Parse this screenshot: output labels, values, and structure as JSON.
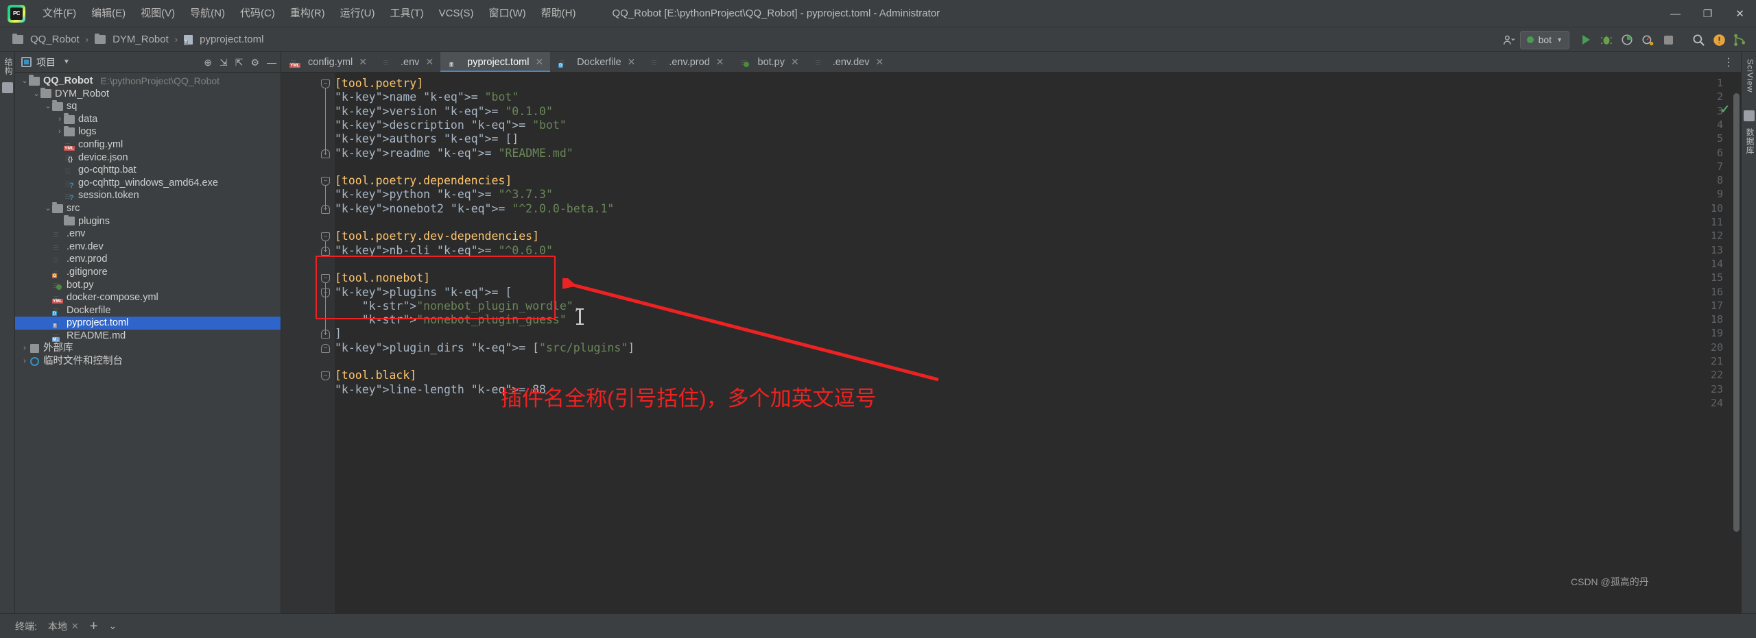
{
  "titlebar": {
    "logo_text": "PC",
    "menus": [
      {
        "label": "文件(F)"
      },
      {
        "label": "编辑(E)"
      },
      {
        "label": "视图(V)"
      },
      {
        "label": "导航(N)"
      },
      {
        "label": "代码(C)"
      },
      {
        "label": "重构(R)"
      },
      {
        "label": "运行(U)"
      },
      {
        "label": "工具(T)"
      },
      {
        "label": "VCS(S)"
      },
      {
        "label": "窗口(W)"
      },
      {
        "label": "帮助(H)"
      }
    ],
    "window_title": "QQ_Robot [E:\\pythonProject\\QQ_Robot] - pyproject.toml - Administrator",
    "minimize": "—",
    "maximize": "❐",
    "close": "✕"
  },
  "navbar": {
    "breadcrumbs": [
      "QQ_Robot",
      "DYM_Robot",
      "pyproject.toml"
    ],
    "separator": "›",
    "run_config": "bot",
    "icons": {
      "user": "👤",
      "run": "run-icon",
      "debug": "debug-icon",
      "coverage": "coverage-icon",
      "profile": "profile-icon",
      "stop": "stop-icon",
      "search": "🔍",
      "updates": "update-icon",
      "git": "git-icon"
    }
  },
  "left_stripe": {
    "label": "结构"
  },
  "right_stripe": {
    "labels": [
      "SciView",
      "数据库"
    ]
  },
  "project_panel": {
    "title": "项目",
    "caret": "▼",
    "tools": [
      "⊕",
      "⇲",
      "⇱",
      "⚙",
      "—"
    ],
    "tree": [
      {
        "depth": 0,
        "arrow": "v",
        "icon": "folder",
        "label": "QQ_Robot",
        "bold": true,
        "path": "E:\\pythonProject\\QQ_Robot",
        "selected": false
      },
      {
        "depth": 1,
        "arrow": "v",
        "icon": "folder",
        "label": "DYM_Robot",
        "bold": false,
        "path": "",
        "selected": false
      },
      {
        "depth": 2,
        "arrow": "v",
        "icon": "folder",
        "label": "sq",
        "bold": false,
        "path": "",
        "selected": false
      },
      {
        "depth": 3,
        "arrow": ">",
        "icon": "folder",
        "label": "data",
        "bold": false,
        "path": "",
        "selected": false
      },
      {
        "depth": 3,
        "arrow": ">",
        "icon": "folder",
        "label": "logs",
        "bold": false,
        "path": "",
        "selected": false
      },
      {
        "depth": 3,
        "arrow": "none",
        "icon": "yml",
        "label": "config.yml",
        "bold": false,
        "path": "",
        "selected": false
      },
      {
        "depth": 3,
        "arrow": "none",
        "icon": "json",
        "label": "device.json",
        "bold": false,
        "path": "",
        "selected": false
      },
      {
        "depth": 3,
        "arrow": "none",
        "icon": "doc",
        "label": "go-cqhttp.bat",
        "bold": false,
        "path": "",
        "selected": false
      },
      {
        "depth": 3,
        "arrow": "none",
        "icon": "unknown",
        "label": "go-cqhttp_windows_amd64.exe",
        "bold": false,
        "path": "",
        "selected": false
      },
      {
        "depth": 3,
        "arrow": "none",
        "icon": "unknown",
        "label": "session.token",
        "bold": false,
        "path": "",
        "selected": false
      },
      {
        "depth": 2,
        "arrow": "v",
        "icon": "folder",
        "label": "src",
        "bold": false,
        "path": "",
        "selected": false
      },
      {
        "depth": 3,
        "arrow": "none",
        "icon": "folder",
        "label": "plugins",
        "bold": false,
        "path": "",
        "selected": false
      },
      {
        "depth": 2,
        "arrow": "none",
        "icon": "doc",
        "label": ".env",
        "bold": false,
        "path": "",
        "selected": false
      },
      {
        "depth": 2,
        "arrow": "none",
        "icon": "doc",
        "label": ".env.dev",
        "bold": false,
        "path": "",
        "selected": false
      },
      {
        "depth": 2,
        "arrow": "none",
        "icon": "doc",
        "label": ".env.prod",
        "bold": false,
        "path": "",
        "selected": false
      },
      {
        "depth": 2,
        "arrow": "none",
        "icon": "git",
        "label": ".gitignore",
        "bold": false,
        "path": "",
        "selected": false
      },
      {
        "depth": 2,
        "arrow": "none",
        "icon": "py",
        "label": "bot.py",
        "bold": false,
        "path": "",
        "selected": false
      },
      {
        "depth": 2,
        "arrow": "none",
        "icon": "yml",
        "label": "docker-compose.yml",
        "bold": false,
        "path": "",
        "selected": false
      },
      {
        "depth": 2,
        "arrow": "none",
        "icon": "docker",
        "label": "Dockerfile",
        "bold": false,
        "path": "",
        "selected": false
      },
      {
        "depth": 2,
        "arrow": "none",
        "icon": "toml",
        "label": "pyproject.toml",
        "bold": false,
        "path": "",
        "selected": true
      },
      {
        "depth": 2,
        "arrow": "none",
        "icon": "md",
        "label": "README.md",
        "bold": false,
        "path": "",
        "selected": false
      },
      {
        "depth": 0,
        "arrow": ">",
        "icon": "lib",
        "label": "外部库",
        "bold": false,
        "path": "",
        "selected": false
      },
      {
        "depth": 0,
        "arrow": ">",
        "icon": "scratch",
        "label": "临时文件和控制台",
        "bold": false,
        "path": "",
        "selected": false
      }
    ]
  },
  "editor": {
    "tabs": [
      {
        "label": "config.yml",
        "icon": "yml",
        "active": false
      },
      {
        "label": ".env",
        "icon": "doc",
        "active": false
      },
      {
        "label": "pyproject.toml",
        "icon": "toml",
        "active": true
      },
      {
        "label": "Dockerfile",
        "icon": "docker",
        "active": false
      },
      {
        "label": ".env.prod",
        "icon": "doc",
        "active": false
      },
      {
        "label": "bot.py",
        "icon": "py",
        "active": false
      },
      {
        "label": ".env.dev",
        "icon": "doc",
        "active": false
      }
    ],
    "tab_close": "✕",
    "more_tabs": "⋮",
    "inspection_ok": "✓",
    "lines": [
      {
        "n": 1,
        "fold": "open",
        "text": "[tool.poetry]",
        "type": "section"
      },
      {
        "n": 2,
        "fold": "",
        "text": "name = \"bot\"",
        "type": "kv"
      },
      {
        "n": 3,
        "fold": "",
        "text": "version = \"0.1.0\"",
        "type": "kv"
      },
      {
        "n": 4,
        "fold": "",
        "text": "description = \"bot\"",
        "type": "kv"
      },
      {
        "n": 5,
        "fold": "",
        "text": "authors = []",
        "type": "kvarr"
      },
      {
        "n": 6,
        "fold": "close",
        "text": "readme = \"README.md\"",
        "type": "kv"
      },
      {
        "n": 7,
        "fold": "",
        "text": "",
        "type": "blank"
      },
      {
        "n": 8,
        "fold": "open",
        "text": "[tool.poetry.dependencies]",
        "type": "section"
      },
      {
        "n": 9,
        "fold": "",
        "text": "python = \"^3.7.3\"",
        "type": "kv"
      },
      {
        "n": 10,
        "fold": "close",
        "text": "nonebot2 = \"^2.0.0-beta.1\"",
        "type": "kv"
      },
      {
        "n": 11,
        "fold": "",
        "text": "",
        "type": "blank"
      },
      {
        "n": 12,
        "fold": "open",
        "text": "[tool.poetry.dev-dependencies]",
        "type": "section"
      },
      {
        "n": 13,
        "fold": "close",
        "text": "nb-cli = \"^0.6.0\"",
        "type": "kv"
      },
      {
        "n": 14,
        "fold": "",
        "text": "",
        "type": "blank"
      },
      {
        "n": 15,
        "fold": "open",
        "text": "[tool.nonebot]",
        "type": "section"
      },
      {
        "n": 16,
        "fold": "open",
        "text": "plugins = [",
        "type": "arropen"
      },
      {
        "n": 17,
        "fold": "",
        "text": "    \"nonebot_plugin_wordle\",",
        "type": "str"
      },
      {
        "n": 18,
        "fold": "",
        "text": "    \"nonebot_plugin_guess\"",
        "type": "str"
      },
      {
        "n": 19,
        "fold": "close",
        "text": "]",
        "type": "arrclose"
      },
      {
        "n": 20,
        "fold": "close",
        "text": "plugin_dirs = [\"src/plugins\"]",
        "type": "kvstr"
      },
      {
        "n": 21,
        "fold": "",
        "text": "",
        "type": "blank"
      },
      {
        "n": 22,
        "fold": "open",
        "text": "[tool.black]",
        "type": "section"
      },
      {
        "n": 23,
        "fold": "",
        "text": "line-length = 88",
        "type": "kvnum"
      },
      {
        "n": 24,
        "fold": "",
        "text": "",
        "type": "blank"
      }
    ]
  },
  "annotation": {
    "box_color": "#ee2222",
    "text": "插件名全称(引号括住)，多个加英文逗号",
    "arrow": "arrow-left-icon"
  },
  "watermark": "CSDN @孤高的丹",
  "bottombar": {
    "terminal_label": "终端:",
    "tab_label": "本地",
    "tab_close": "✕",
    "add": "+",
    "dropdown": "⌄"
  }
}
